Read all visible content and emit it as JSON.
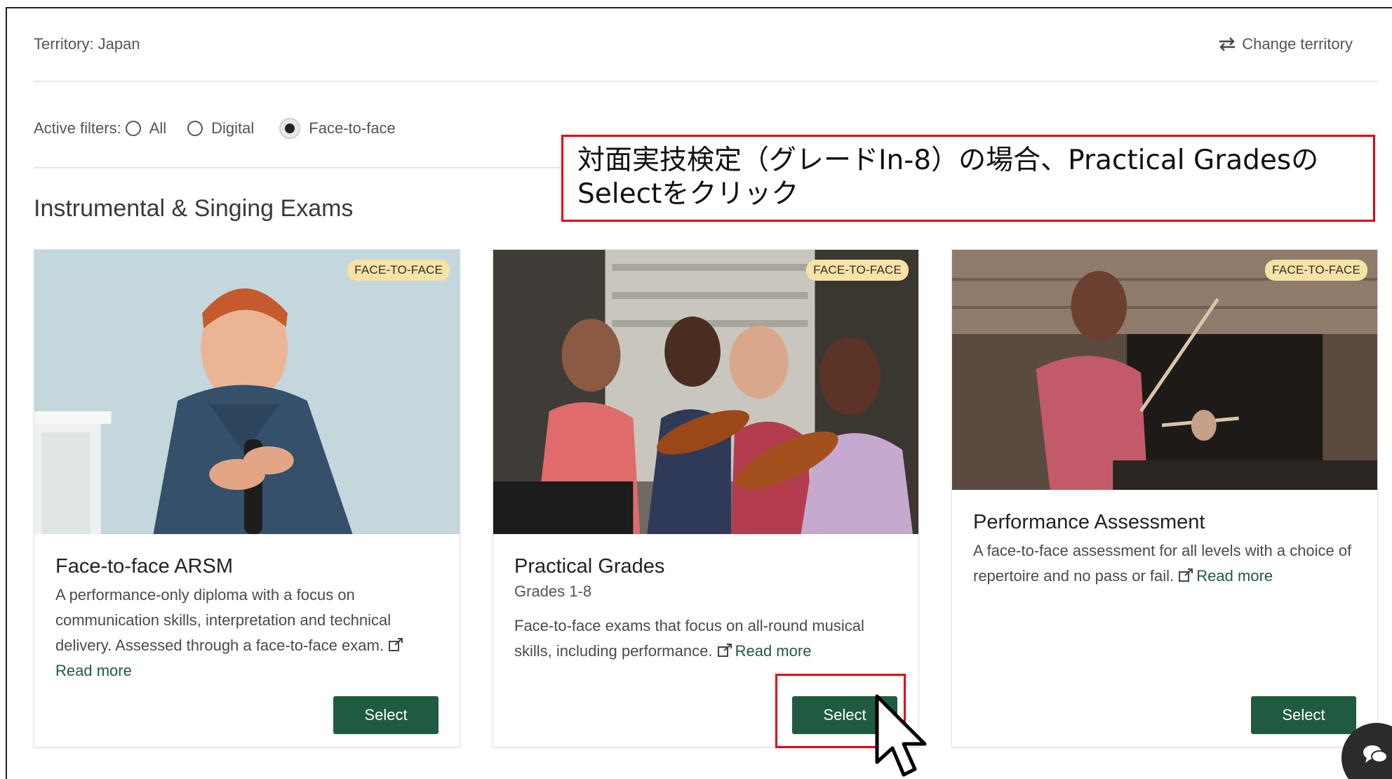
{
  "header": {
    "territory": "Territory: Japan",
    "change_territory": "Change territory"
  },
  "filters": {
    "label": "Active filters:",
    "options": [
      "All",
      "Digital",
      "Face-to-face"
    ],
    "selected": "Face-to-face"
  },
  "section": {
    "title": "Instrumental & Singing Exams"
  },
  "annotation": {
    "text": "対面実技検定（グレードIn-8）の場合、Practical GradesのSelectをクリック"
  },
  "cards": [
    {
      "badge": "FACE-TO-FACE",
      "title": "Face-to-face ARSM",
      "subtitle": "",
      "description": "A performance-only diploma with a focus on communication skills, interpretation and technical delivery. Assessed through a face-to-face exam.",
      "read_more": "Read more",
      "button": "Select"
    },
    {
      "badge": "FACE-TO-FACE",
      "title": "Practical Grades",
      "subtitle": "Grades 1-8",
      "description": "Face-to-face exams that focus on all-round musical skills, including performance.",
      "read_more": "Read more",
      "button": "Select"
    },
    {
      "badge": "FACE-TO-FACE",
      "title": "Performance Assessment",
      "subtitle": "",
      "description": "A face-to-face assessment for all levels with a choice of repertoire and no pass or fail.",
      "read_more": "Read more",
      "button": "Select"
    }
  ],
  "colors": {
    "primary_button": "#1e5b40",
    "link": "#1f5a40",
    "badge_bg": "#f6e3a5",
    "annotation_border": "#e60012"
  },
  "icons": {
    "change_territory": "swap-arrows-icon",
    "external_link": "external-link-icon",
    "chat": "chat-icon",
    "cursor": "mouse-pointer-icon"
  }
}
